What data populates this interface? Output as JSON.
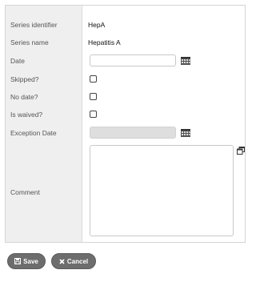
{
  "form": {
    "series_identifier": {
      "label": "Series identifier",
      "value": "HepA"
    },
    "series_name": {
      "label": "Series name",
      "value": "Hepatitis A"
    },
    "date": {
      "label": "Date",
      "value": ""
    },
    "skipped": {
      "label": "Skipped?",
      "checked": false
    },
    "no_date": {
      "label": "No date?",
      "checked": false
    },
    "is_waived": {
      "label": "Is waived?",
      "checked": false
    },
    "exception_date": {
      "label": "Exception Date",
      "value": "",
      "disabled": true
    },
    "comment": {
      "label": "Comment",
      "value": ""
    }
  },
  "buttons": {
    "save_label": "Save",
    "save_icon": "floppy-disk-icon",
    "cancel_label": "Cancel",
    "cancel_icon": "x-icon"
  },
  "colors": {
    "label_column_bg": "#efefef",
    "button_bg": "#6d6d6d",
    "disabled_input_bg": "#dedede"
  }
}
